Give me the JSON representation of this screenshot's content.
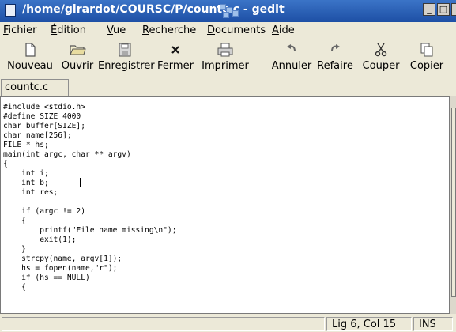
{
  "window": {
    "title": "/home/girardot/COURSC/P/countc.c - gedit",
    "title_icon": "document-icon",
    "wm_buttons": [
      "_",
      "□"
    ]
  },
  "menubar": {
    "items": [
      {
        "label": "Fichier",
        "mnemonic": "F"
      },
      {
        "label": "Édition",
        "mnemonic": "É"
      },
      {
        "label": "Vue",
        "mnemonic": "V"
      },
      {
        "label": "Recherche",
        "mnemonic": "R"
      },
      {
        "label": "Documents",
        "mnemonic": "D"
      },
      {
        "label": "Aide",
        "mnemonic": "A"
      }
    ]
  },
  "toolbar": {
    "items": [
      {
        "label": "Nouveau",
        "icon": "new-document-icon"
      },
      {
        "label": "Ouvrir",
        "icon": "open-folder-icon"
      },
      {
        "label": "Enregistrer",
        "icon": "save-floppy-icon"
      },
      {
        "label": "Fermer",
        "icon": "close-icon"
      },
      {
        "label": "Imprimer",
        "icon": "printer-icon"
      },
      {
        "label": "Annuler",
        "icon": "undo-icon"
      },
      {
        "label": "Refaire",
        "icon": "redo-icon"
      },
      {
        "label": "Couper",
        "icon": "scissors-icon"
      },
      {
        "label": "Copier",
        "icon": "copy-icon"
      }
    ]
  },
  "tabs": [
    {
      "label": "countc.c",
      "active": true
    }
  ],
  "editor": {
    "code": "#include <stdio.h>\n#define SIZE 4000\nchar buffer[SIZE];\nchar name[256];\nFILE * hs;\nmain(int argc, char ** argv)\n{\n    int i;\n    int b;\n    int res;\n\n    if (argc != 2)\n    {\n        printf(\"File name missing\\n\");\n        exit(1);\n    }\n    strcpy(name, argv[1]);\n    hs = fopen(name,\"r\");\n    if (hs == NULL)\n    {",
    "cursor": {
      "line": 6,
      "column": 15
    }
  },
  "statusbar": {
    "position": "Lig 6, Col 15",
    "mode": "INS"
  },
  "colors": {
    "titlebar": "#2a5fb6",
    "chrome": "#ece9d8",
    "editor_bg": "#ffffff"
  }
}
